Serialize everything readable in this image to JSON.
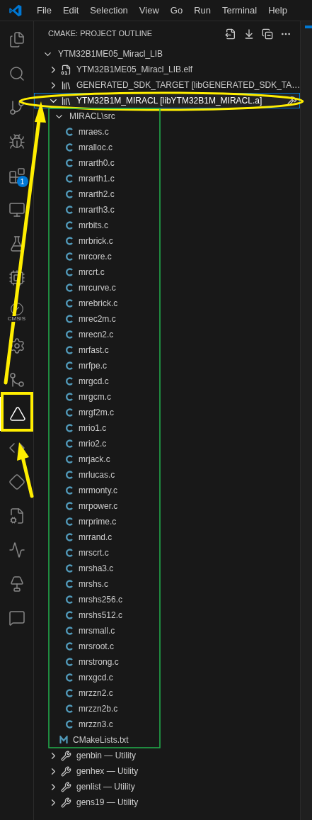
{
  "menu": [
    "File",
    "Edit",
    "Selection",
    "View",
    "Go",
    "Run",
    "Terminal",
    "Help"
  ],
  "activity_bar": [
    {
      "kind": "explorer",
      "selected": false
    },
    {
      "kind": "search",
      "selected": false
    },
    {
      "kind": "source-control",
      "selected": false
    },
    {
      "kind": "run-debug",
      "selected": false
    },
    {
      "kind": "extensions",
      "selected": false,
      "badge": "1"
    },
    {
      "kind": "remote",
      "selected": false
    },
    {
      "kind": "testing",
      "selected": false
    },
    {
      "kind": "chip",
      "selected": false
    },
    {
      "kind": "cmsis",
      "selected": false,
      "label": "CMSIS"
    },
    {
      "kind": "package",
      "selected": false
    },
    {
      "kind": "git-graph",
      "selected": false
    },
    {
      "kind": "cmake",
      "selected": true
    },
    {
      "kind": "python",
      "selected": false
    },
    {
      "kind": "logo",
      "selected": false
    },
    {
      "kind": "settings-file",
      "selected": false
    },
    {
      "kind": "wave",
      "selected": false
    },
    {
      "kind": "lamp",
      "selected": false
    },
    {
      "kind": "chat",
      "selected": false
    }
  ],
  "panel": {
    "title": "CMAKE: PROJECT OUTLINE",
    "tree": [
      {
        "label": "YTM32B1ME05_Miracl_LIB",
        "expanded": true,
        "selected": false,
        "children": [
          {
            "label": "YTM32B1ME05_Miracl_LIB.elf",
            "kind": "executable",
            "expanded": false,
            "selected": false
          },
          {
            "label": "GENERATED_SDK_TARGET [libGENERATED_SDK_TA…",
            "kind": "library",
            "expanded": false,
            "selected": false
          },
          {
            "label": "YTM32B1M_MIRACL [libYTM32B1M_MIRACL.a]",
            "kind": "library",
            "expanded": true,
            "selected": true,
            "children": [
              {
                "label": "MIRACL\\src",
                "expanded": true,
                "selected": false,
                "children": [
                  {
                    "label": "mraes.c",
                    "kind": "c",
                    "selected": false
                  },
                  {
                    "label": "mralloc.c",
                    "kind": "c",
                    "selected": false
                  },
                  {
                    "label": "mrarth0.c",
                    "kind": "c",
                    "selected": false
                  },
                  {
                    "label": "mrarth1.c",
                    "kind": "c",
                    "selected": false
                  },
                  {
                    "label": "mrarth2.c",
                    "kind": "c",
                    "selected": false
                  },
                  {
                    "label": "mrarth3.c",
                    "kind": "c",
                    "selected": false
                  },
                  {
                    "label": "mrbits.c",
                    "kind": "c",
                    "selected": false
                  },
                  {
                    "label": "mrbrick.c",
                    "kind": "c",
                    "selected": false
                  },
                  {
                    "label": "mrcore.c",
                    "kind": "c",
                    "selected": false
                  },
                  {
                    "label": "mrcrt.c",
                    "kind": "c",
                    "selected": false
                  },
                  {
                    "label": "mrcurve.c",
                    "kind": "c",
                    "selected": false
                  },
                  {
                    "label": "mrebrick.c",
                    "kind": "c",
                    "selected": false
                  },
                  {
                    "label": "mrec2m.c",
                    "kind": "c",
                    "selected": false
                  },
                  {
                    "label": "mrecn2.c",
                    "kind": "c",
                    "selected": false
                  },
                  {
                    "label": "mrfast.c",
                    "kind": "c",
                    "selected": false
                  },
                  {
                    "label": "mrfpe.c",
                    "kind": "c",
                    "selected": false
                  },
                  {
                    "label": "mrgcd.c",
                    "kind": "c",
                    "selected": false
                  },
                  {
                    "label": "mrgcm.c",
                    "kind": "c",
                    "selected": false
                  },
                  {
                    "label": "mrgf2m.c",
                    "kind": "c",
                    "selected": false
                  },
                  {
                    "label": "mrio1.c",
                    "kind": "c",
                    "selected": false
                  },
                  {
                    "label": "mrio2.c",
                    "kind": "c",
                    "selected": false
                  },
                  {
                    "label": "mrjack.c",
                    "kind": "c",
                    "selected": false
                  },
                  {
                    "label": "mrlucas.c",
                    "kind": "c",
                    "selected": false
                  },
                  {
                    "label": "mrmonty.c",
                    "kind": "c",
                    "selected": false
                  },
                  {
                    "label": "mrpower.c",
                    "kind": "c",
                    "selected": false
                  },
                  {
                    "label": "mrprime.c",
                    "kind": "c",
                    "selected": false
                  },
                  {
                    "label": "mrrand.c",
                    "kind": "c",
                    "selected": false
                  },
                  {
                    "label": "mrscrt.c",
                    "kind": "c",
                    "selected": false
                  },
                  {
                    "label": "mrsha3.c",
                    "kind": "c",
                    "selected": false
                  },
                  {
                    "label": "mrshs.c",
                    "kind": "c",
                    "selected": false
                  },
                  {
                    "label": "mrshs256.c",
                    "kind": "c",
                    "selected": false
                  },
                  {
                    "label": "mrshs512.c",
                    "kind": "c",
                    "selected": false
                  },
                  {
                    "label": "mrsmall.c",
                    "kind": "c",
                    "selected": false
                  },
                  {
                    "label": "mrsroot.c",
                    "kind": "c",
                    "selected": false
                  },
                  {
                    "label": "mrstrong.c",
                    "kind": "c",
                    "selected": false
                  },
                  {
                    "label": "mrxgcd.c",
                    "kind": "c",
                    "selected": false
                  },
                  {
                    "label": "mrzzn2.c",
                    "kind": "c",
                    "selected": false
                  },
                  {
                    "label": "mrzzn2b.c",
                    "kind": "c",
                    "selected": false
                  },
                  {
                    "label": "mrzzn3.c",
                    "kind": "c",
                    "selected": false
                  }
                ]
              },
              {
                "label": "CMakeLists.txt",
                "kind": "cmake",
                "selected": false
              }
            ]
          },
          {
            "label": "genbin — Utility",
            "kind": "utility",
            "expanded": false,
            "selected": false
          },
          {
            "label": "genhex — Utility",
            "kind": "utility",
            "expanded": false,
            "selected": false
          },
          {
            "label": "genlist — Utility",
            "kind": "utility",
            "expanded": false,
            "selected": false
          },
          {
            "label": "gens19 — Utility",
            "kind": "utility",
            "expanded": false,
            "selected": false
          }
        ]
      }
    ]
  }
}
